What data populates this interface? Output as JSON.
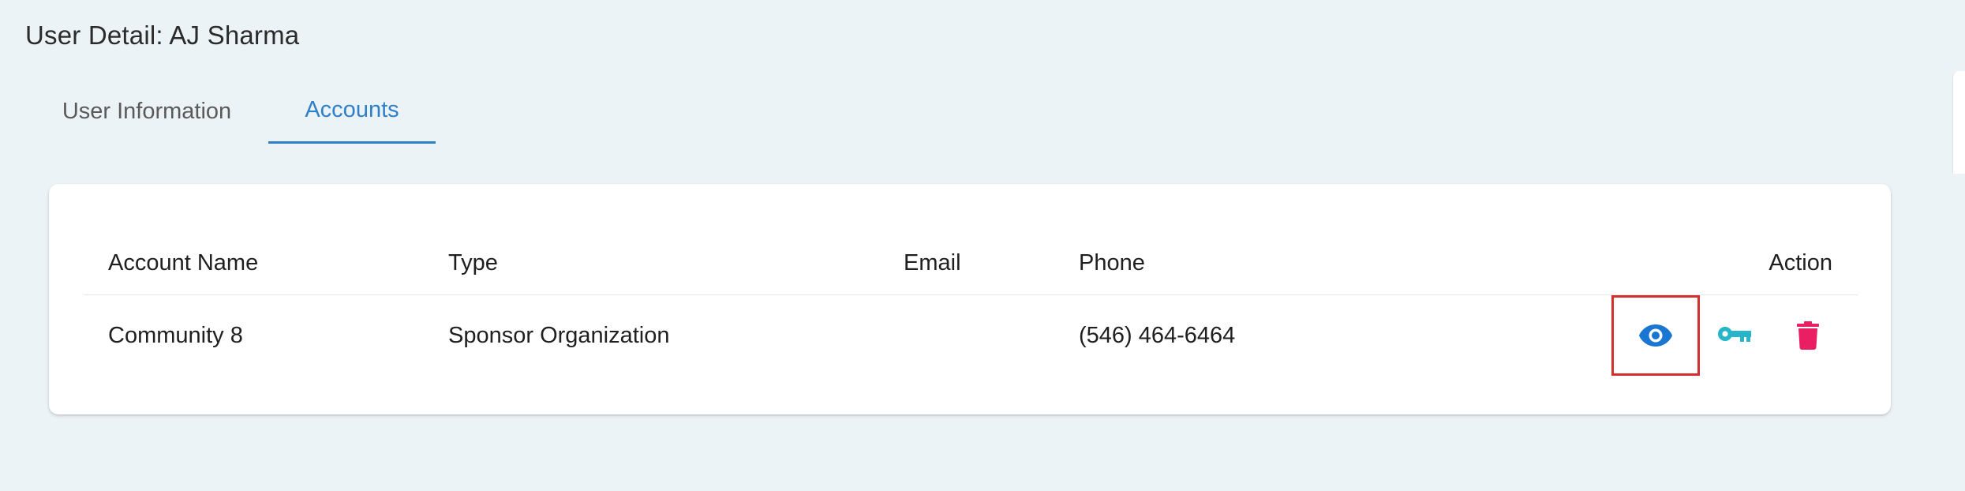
{
  "page": {
    "title": "User Detail: AJ Sharma"
  },
  "tabs": [
    {
      "label": "User Information",
      "active": false
    },
    {
      "label": "Accounts",
      "active": true
    }
  ],
  "table": {
    "columns": [
      "Account Name",
      "Type",
      "Email",
      "Phone",
      "Action"
    ],
    "rows": [
      {
        "account_name": "Community 8",
        "type": "Sponsor Organization",
        "email": "",
        "phone": "(546) 464-6464",
        "actions": [
          "eye-icon",
          "key-icon",
          "delete-icon"
        ]
      }
    ]
  },
  "colors": {
    "accent": "#2f80c7",
    "view_icon": "#1976d2",
    "key_icon": "#26b5c9",
    "delete_icon": "#e91e63",
    "highlight": "#d32f2f"
  }
}
